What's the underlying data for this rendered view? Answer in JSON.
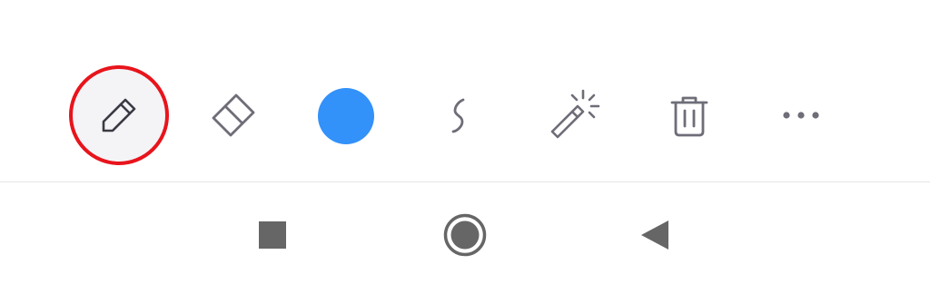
{
  "toolbar": {
    "tools": [
      {
        "name": "pen",
        "icon": "pencil-icon",
        "selected": true
      },
      {
        "name": "eraser",
        "icon": "eraser-icon",
        "selected": false
      },
      {
        "name": "color",
        "icon": "color-swatch",
        "selected": false
      },
      {
        "name": "stroke",
        "icon": "squiggle-icon",
        "selected": false
      },
      {
        "name": "magic",
        "icon": "magic-wand-icon",
        "selected": false
      },
      {
        "name": "delete",
        "icon": "trash-icon",
        "selected": false
      },
      {
        "name": "more",
        "icon": "more-horizontal-icon",
        "selected": false
      }
    ],
    "current_color": "#3391fa",
    "selection_ring_color": "#e8141c",
    "icon_color": "#6e6d78"
  },
  "navbar": {
    "buttons": [
      {
        "name": "recents",
        "icon": "square-icon"
      },
      {
        "name": "home",
        "icon": "circle-home-icon"
      },
      {
        "name": "back",
        "icon": "back-triangle-icon"
      }
    ],
    "icon_color": "#666666"
  }
}
